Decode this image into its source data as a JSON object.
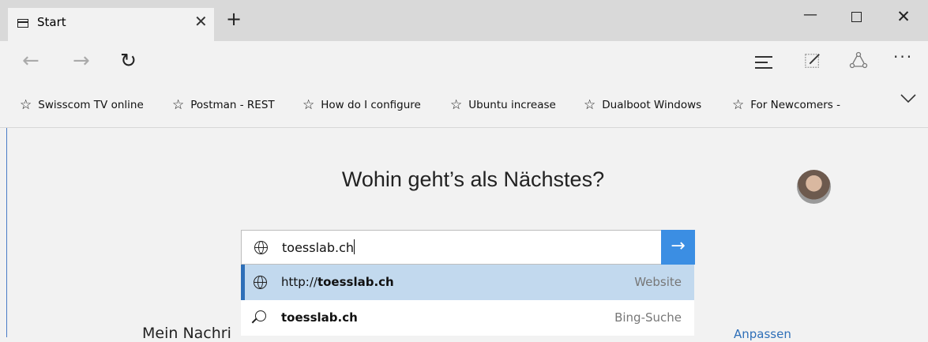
{
  "tab": {
    "title": "Start"
  },
  "window_controls": {
    "minimize": "—",
    "close": "✕"
  },
  "nav": {
    "back": "←",
    "forward": "→",
    "refresh": "↻",
    "more": "···"
  },
  "favorites": [
    {
      "label": "Swisscom TV online"
    },
    {
      "label": "Postman - REST"
    },
    {
      "label": "How do I configure"
    },
    {
      "label": "Ubuntu increase"
    },
    {
      "label": "Dualboot Windows"
    },
    {
      "label": "For Newcomers -"
    }
  ],
  "page": {
    "headline": "Wohin geht’s als Nächstes?",
    "news_heading": "Mein Nachri",
    "customize_link": "Anpassen"
  },
  "search": {
    "value": "toesslab.ch",
    "go": "→"
  },
  "suggestions": [
    {
      "prefix": "http://",
      "bold": "toesslab.ch",
      "type": "Website",
      "icon": "globe-icon",
      "selected": true
    },
    {
      "prefix": "",
      "bold": "toesslab.ch",
      "type": "Bing-Suche",
      "icon": "search-icon",
      "selected": false
    }
  ],
  "colors": {
    "accent": "#3b8ee3",
    "selection": "#c2d9ee",
    "link": "#2e6fb8"
  }
}
